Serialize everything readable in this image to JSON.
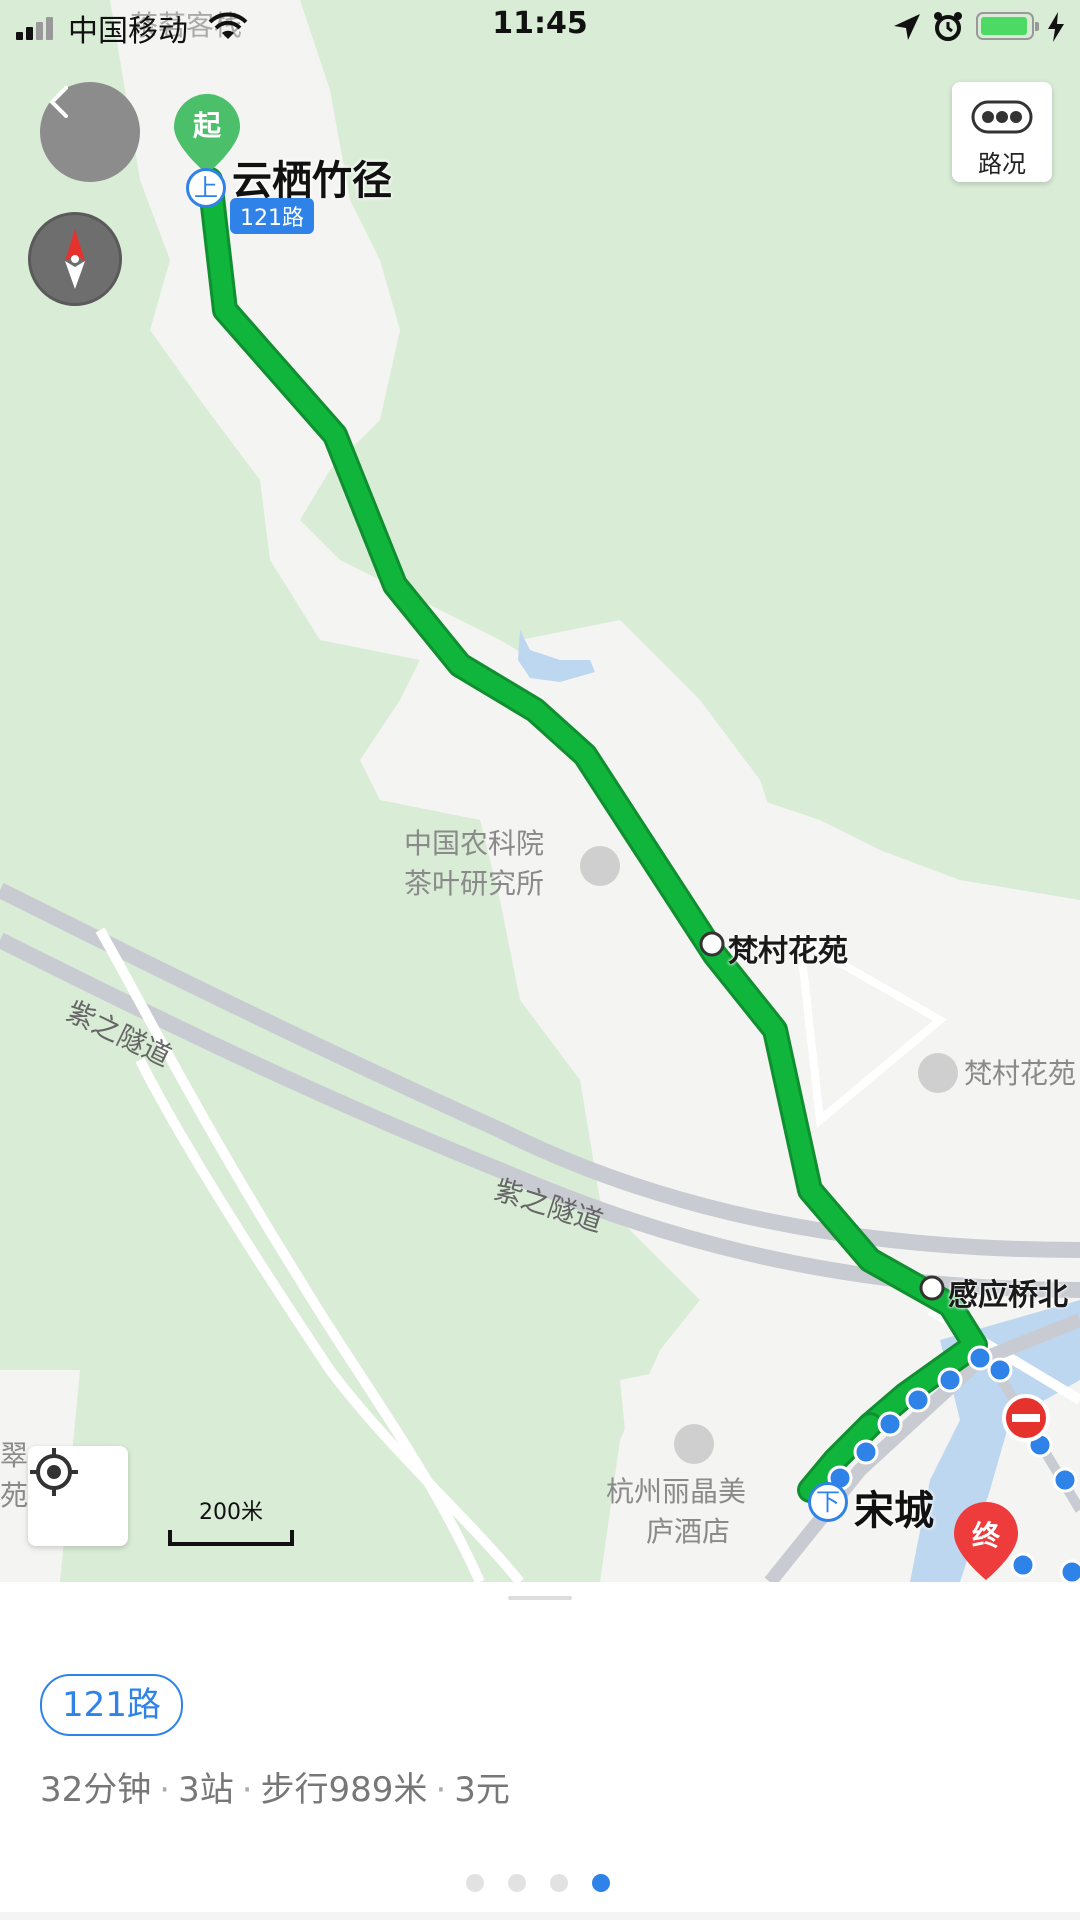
{
  "status_bar": {
    "carrier": "中国移动",
    "time": "11:45",
    "battery_color": "#4cd964"
  },
  "map": {
    "top_cut_label": "茶茗客栈",
    "traffic_button_label": "路况",
    "scale_label": "200米",
    "start_pin_label": "起",
    "end_pin_label": "终",
    "board_marker": "上",
    "alight_marker": "下",
    "route_tag": "121路",
    "stops": {
      "start": "云栖竹径",
      "mid1": "梵村花苑",
      "mid2": "感应桥北",
      "end": "宋城"
    },
    "pois": {
      "tea_institute_line1": "中国农科院",
      "tea_institute_line2": "茶叶研究所",
      "fancun": "梵村花苑",
      "hotel_line1": "杭州丽晶美",
      "hotel_line2": "庐酒店",
      "left_cut_line1": "翠",
      "left_cut_line2": "苑大"
    },
    "roads": {
      "tunnel_1": "紫之隧道",
      "tunnel_2": "紫之隧道"
    },
    "colors": {
      "bus_route": "#10b53c",
      "walk_route": "#2f83e8",
      "land": "#d9ecd6",
      "urban": "#f4f4f2"
    }
  },
  "panel": {
    "route_name": "121路",
    "duration": "32分钟",
    "stops": "3站",
    "walk": "步行989米",
    "fare": "3元",
    "pages": 4,
    "active_page": 4
  }
}
